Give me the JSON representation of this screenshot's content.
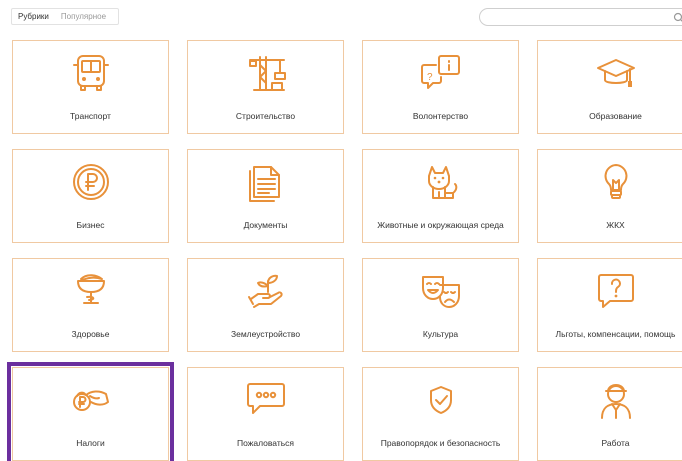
{
  "tabs": [
    {
      "label": "Рубрики",
      "active": true
    },
    {
      "label": "Популярное",
      "active": false
    }
  ],
  "search": {
    "placeholder": "",
    "icon": "search-icon"
  },
  "categories": [
    {
      "label": "Транспорт",
      "icon": "bus-icon"
    },
    {
      "label": "Строительство",
      "icon": "crane-icon"
    },
    {
      "label": "Волонтерство",
      "icon": "chat-bubbles-icon"
    },
    {
      "label": "Образование",
      "icon": "graduation-cap-icon"
    },
    {
      "label": "Бизнес",
      "icon": "ruble-coin-icon"
    },
    {
      "label": "Документы",
      "icon": "document-icon"
    },
    {
      "label": "Животные и окружающая среда",
      "icon": "dog-icon"
    },
    {
      "label": "ЖКХ",
      "icon": "lightbulb-icon"
    },
    {
      "label": "Здоровье",
      "icon": "hygieia-bowl-icon"
    },
    {
      "label": "Землеустройство",
      "icon": "plant-hand-icon"
    },
    {
      "label": "Культура",
      "icon": "theater-masks-icon"
    },
    {
      "label": "Льготы, компенсации, помощь",
      "icon": "question-bubble-icon"
    },
    {
      "label": "Налоги",
      "icon": "hand-coins-icon"
    },
    {
      "label": "Пожаловаться",
      "icon": "message-dots-icon"
    },
    {
      "label": "Правопорядок и безопасность",
      "icon": "shield-check-icon"
    },
    {
      "label": "Работа",
      "icon": "worker-icon"
    }
  ],
  "selected_index": 12,
  "colors": {
    "accent": "#e8913a",
    "card_border": "#f0c9a2",
    "selection": "#6b2f9e"
  }
}
